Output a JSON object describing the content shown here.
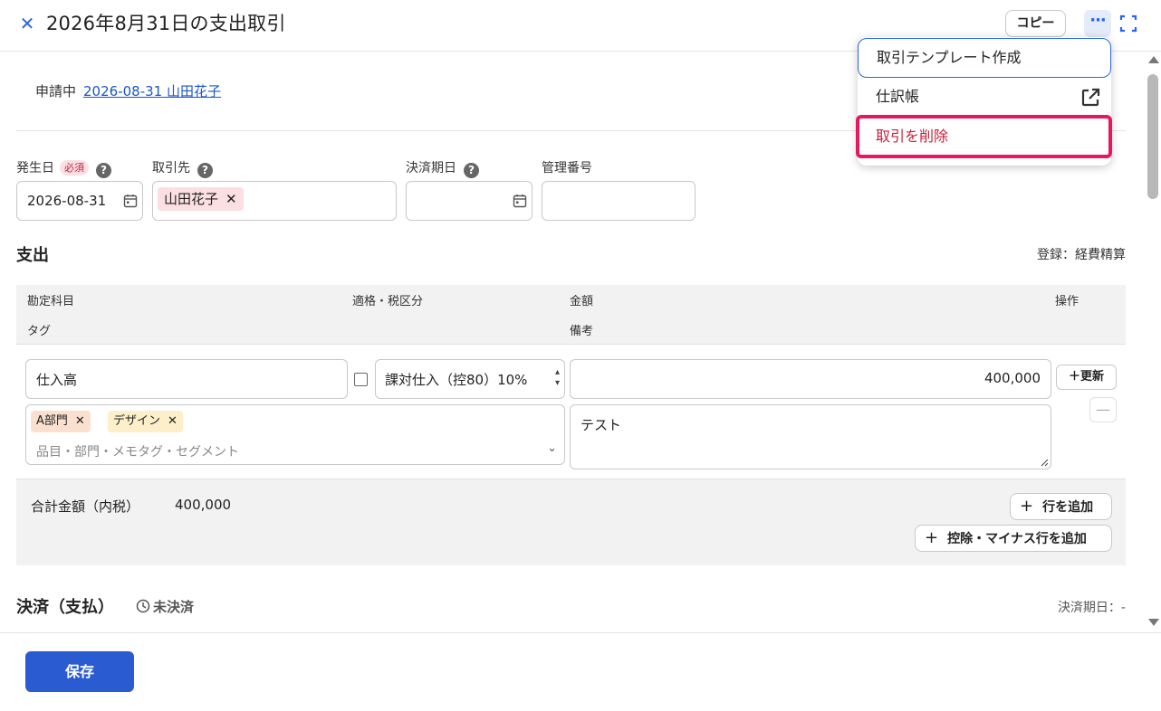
{
  "header": {
    "title": "2026年8月31日の支出取引",
    "copy_label": "コピー",
    "more_label": "···"
  },
  "status": {
    "label": "申請中",
    "link_text": "2026-08-31 山田花子"
  },
  "fields": {
    "date_label": "発生日",
    "required_badge": "必須",
    "date_value": "2026-08-31",
    "partner_label": "取引先",
    "partner_chip": "山田花子",
    "due_label": "決済期日",
    "mgmt_label": "管理番号"
  },
  "expense": {
    "title": "支出",
    "reg_note": "登録：経費精算",
    "headers": {
      "account": "勘定科目",
      "tax": "適格・税区分",
      "amount": "金額",
      "ops": "操作",
      "tag": "タグ",
      "memo": "備考"
    },
    "row": {
      "account": "仕入高",
      "tax": "課対仕入（控80）10%",
      "amount": "400,000",
      "update_label": "＋更新",
      "minus_label": "—",
      "tags": [
        "A部門",
        "デザイン"
      ],
      "tag_placeholder": "品目・部門・メモタグ・セグメント",
      "memo": "テスト"
    },
    "total_label": "合計金額（内税）",
    "total_value": "400,000",
    "add_row_label": "行を追加",
    "add_deduct_label": "控除・マイナス行を追加"
  },
  "settlement": {
    "title": "決済（支払）",
    "status": "未決済",
    "due_note": "決済期日：-"
  },
  "footer": {
    "save_label": "保存"
  },
  "menu": {
    "items": [
      "取引テンプレート作成",
      "仕訳帳",
      "取引を削除"
    ]
  },
  "colors": {
    "accent": "#2864f0",
    "save": "#2a5bd0",
    "danger": "#c8203c",
    "highlight": "#e8185f"
  }
}
